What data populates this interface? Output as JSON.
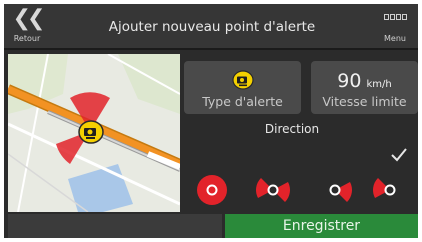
{
  "header": {
    "back_label": "Retour",
    "title": "Ajouter nouveau point d'alerte",
    "menu_label": "Menu"
  },
  "alert_type": {
    "label": "Type d'alerte",
    "icon": "speed-camera-icon"
  },
  "speed_limit": {
    "value": "90",
    "unit": "km/h",
    "label": "Vitesse limite"
  },
  "direction": {
    "label": "Direction",
    "options": [
      {
        "name": "dir-option-1",
        "icon": "circle-filled-red"
      },
      {
        "name": "dir-option-2",
        "icon": "two-sided-sectors"
      },
      {
        "name": "dir-option-3",
        "icon": "single-sector-right"
      },
      {
        "name": "dir-option-4",
        "icon": "single-sector-left"
      }
    ],
    "selected_index": 3
  },
  "save_label": "Enregistrer",
  "colors": {
    "accent_red": "#e2232a",
    "save_green": "#2a8a3a",
    "camera_yellow": "#f4d000",
    "road_orange": "#f29223"
  }
}
